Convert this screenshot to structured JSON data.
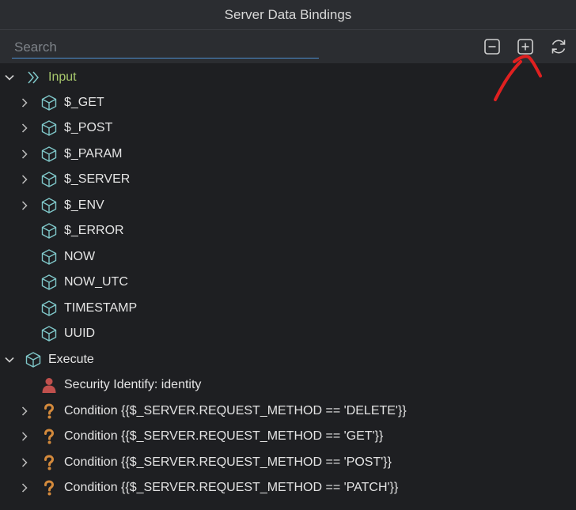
{
  "window": {
    "title": "Server Data Bindings"
  },
  "toolbar": {
    "search_placeholder": "Search",
    "collapse_icon": "minus-square-icon",
    "expand_icon": "plus-square-icon",
    "refresh_icon": "refresh-icon"
  },
  "tree": {
    "input": {
      "label": "Input",
      "icon": "double-chevron-right-icon",
      "children": [
        {
          "label": "$_GET",
          "expandable": true
        },
        {
          "label": "$_POST",
          "expandable": true
        },
        {
          "label": "$_PARAM",
          "expandable": true
        },
        {
          "label": "$_SERVER",
          "expandable": true
        },
        {
          "label": "$_ENV",
          "expandable": true
        },
        {
          "label": "$_ERROR",
          "expandable": false
        },
        {
          "label": "NOW",
          "expandable": false
        },
        {
          "label": "NOW_UTC",
          "expandable": false
        },
        {
          "label": "TIMESTAMP",
          "expandable": false
        },
        {
          "label": "UUID",
          "expandable": false
        }
      ]
    },
    "execute": {
      "label": "Execute",
      "children": [
        {
          "label": "Security Identify: identity",
          "icon": "user-icon",
          "expandable": false
        },
        {
          "label": "Condition {{$_SERVER.REQUEST_METHOD == 'DELETE'}}",
          "icon": "question-icon",
          "expandable": true
        },
        {
          "label": "Condition {{$_SERVER.REQUEST_METHOD == 'GET'}}",
          "icon": "question-icon",
          "expandable": true
        },
        {
          "label": "Condition {{$_SERVER.REQUEST_METHOD == 'POST'}}",
          "icon": "question-icon",
          "expandable": true
        },
        {
          "label": "Condition {{$_SERVER.REQUEST_METHOD == 'PATCH'}}",
          "icon": "question-icon",
          "expandable": true
        }
      ]
    }
  },
  "colors": {
    "cube": "#7fc7c9",
    "input_label": "#a7c76c",
    "question": "#d48a3c",
    "user": "#c0504d",
    "annotation": "#e02020"
  }
}
